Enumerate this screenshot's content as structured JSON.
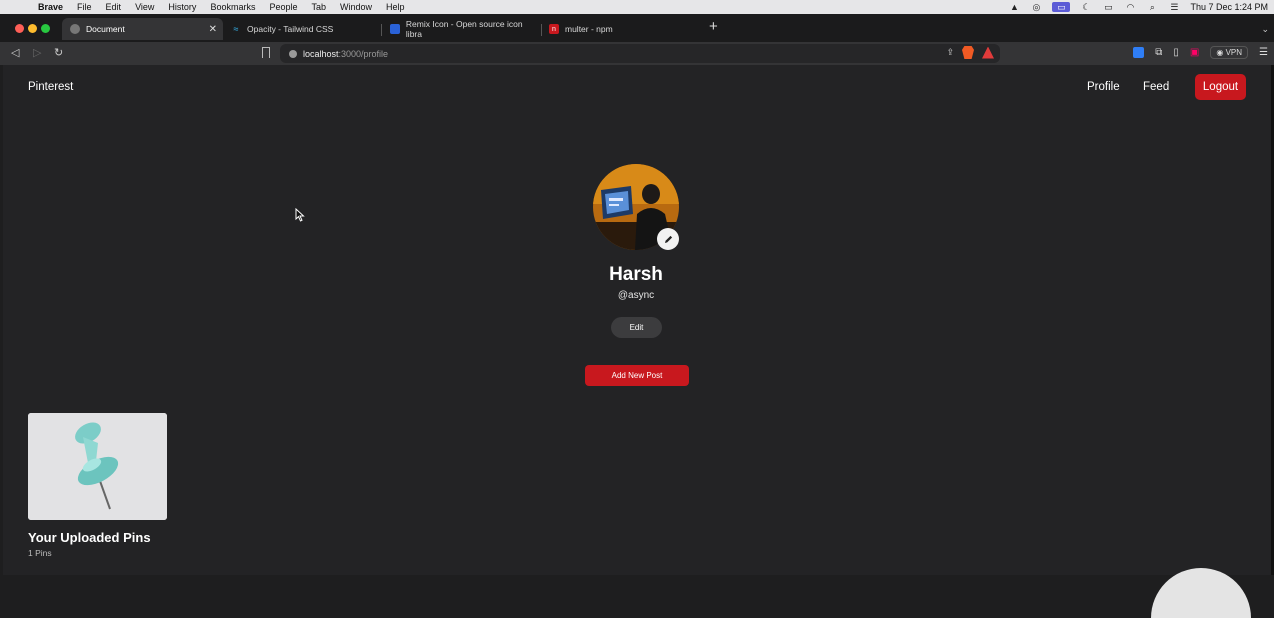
{
  "menubar": {
    "app": "Brave",
    "items": [
      "File",
      "Edit",
      "View",
      "History",
      "Bookmarks",
      "People",
      "Tab",
      "Window",
      "Help"
    ],
    "clock": "Thu 7 Dec  1:24 PM"
  },
  "tabs": [
    {
      "label": "Document",
      "icon": "globe-icon"
    },
    {
      "label": "Opacity - Tailwind CSS",
      "icon": "tailwind-icon"
    },
    {
      "label": "Remix Icon - Open source icon libra",
      "icon": "remix-icon"
    },
    {
      "label": "multer - npm",
      "icon": "npm-icon"
    }
  ],
  "toolbar": {
    "url_host": "localhost",
    "url_path": ":3000/profile",
    "vpn_label": "VPN"
  },
  "site": {
    "brand": "Pinterest",
    "nav": {
      "profile": "Profile",
      "feed": "Feed",
      "logout": "Logout"
    }
  },
  "profile": {
    "name": "Harsh",
    "handle": "@async",
    "edit_label": "Edit",
    "add_post_label": "Add New Post"
  },
  "uploads": {
    "title": "Your Uploaded Pins",
    "count": "1 Pins"
  },
  "colors": {
    "accent": "#c8181e",
    "page_bg": "#232325"
  }
}
